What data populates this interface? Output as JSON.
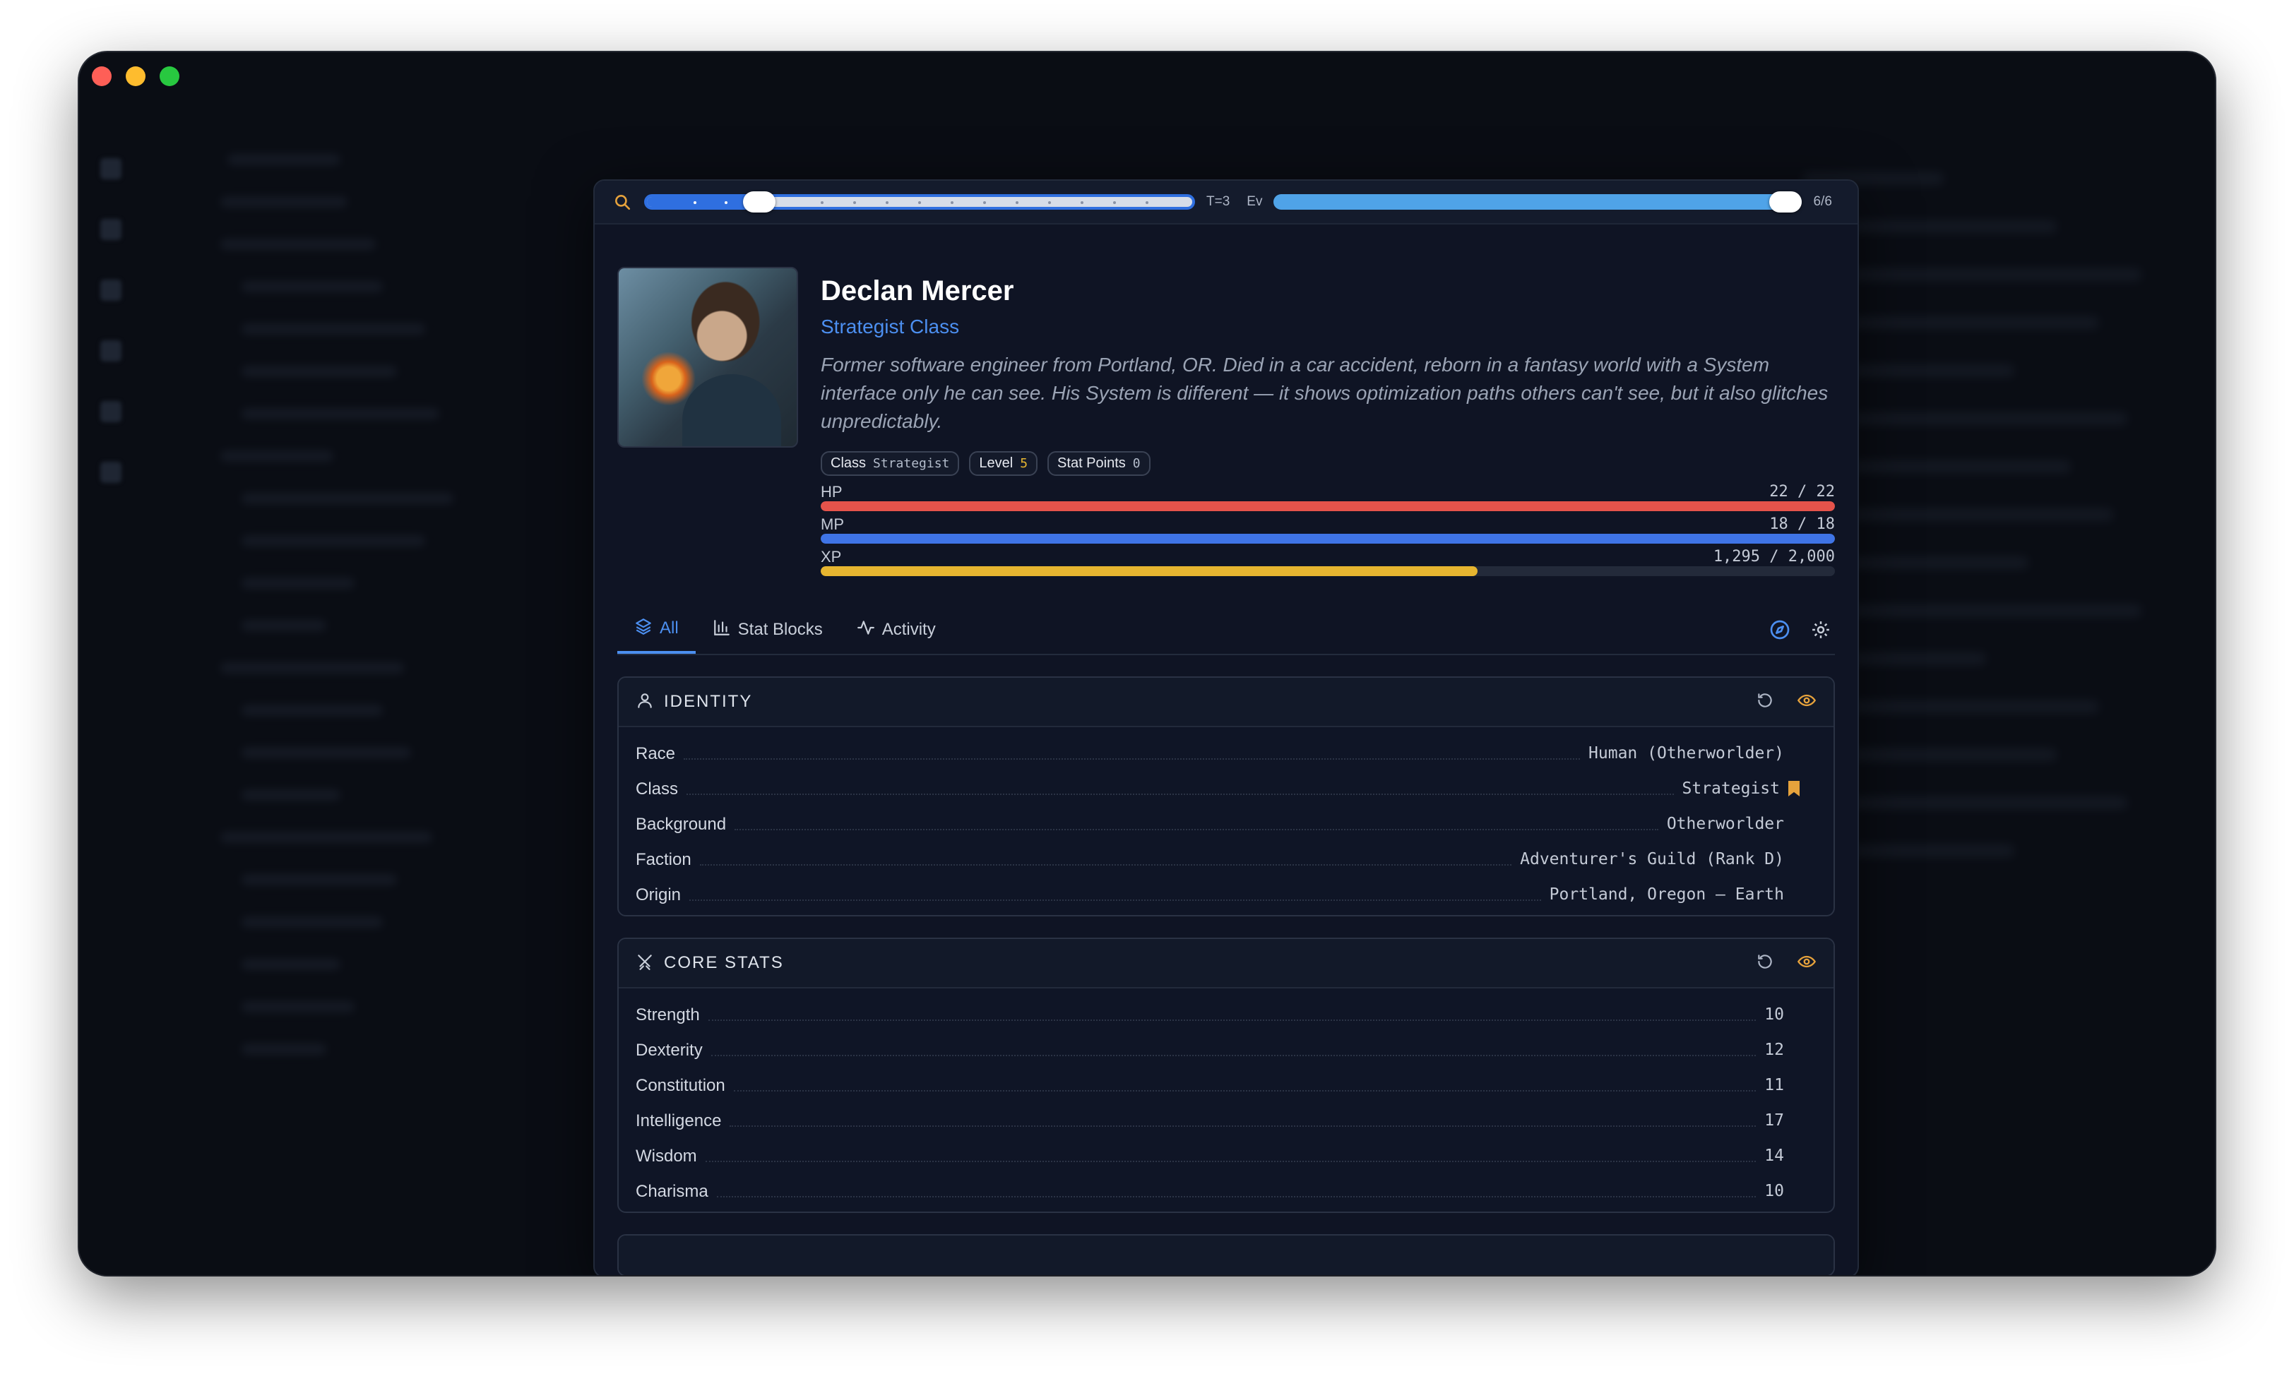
{
  "window": {
    "controls": [
      "close",
      "minimize",
      "zoom"
    ]
  },
  "topbar": {
    "timeline_label": "T=3",
    "timeline_progress": 0.2,
    "ev_label": "Ev",
    "ev_value": "6/6",
    "ev_progress": 1.0
  },
  "character": {
    "name": "Declan Mercer",
    "class_title": "Strategist Class",
    "bio": "Former software engineer from Portland, OR. Died in a car accident, reborn in a fantasy world with a System interface only he can see. His System is different — it shows optimization paths others can't see, but it also glitches unpredictably.",
    "chips": [
      {
        "label": "Class",
        "value": "Strategist"
      },
      {
        "label": "Level",
        "value": "5"
      },
      {
        "label": "Stat Points",
        "value": "0"
      }
    ],
    "bars": [
      {
        "label": "HP",
        "value_text": "22 / 22",
        "fraction": 1.0,
        "color": "#e5534b"
      },
      {
        "label": "MP",
        "value_text": "18 / 18",
        "fraction": 1.0,
        "color": "#3f74e6"
      },
      {
        "label": "XP",
        "value_text": "1,295 / 2,000",
        "fraction": 0.6475,
        "color": "#e6b530"
      }
    ]
  },
  "tabs": [
    {
      "label": "All",
      "icon": "layers-icon",
      "active": true
    },
    {
      "label": "Stat Blocks",
      "icon": "bar-chart-icon",
      "active": false
    },
    {
      "label": "Activity",
      "icon": "activity-icon",
      "active": false
    }
  ],
  "sections": {
    "identity": {
      "title": "IDENTITY",
      "rows": [
        {
          "key": "Race",
          "value": "Human (Otherworlder)"
        },
        {
          "key": "Class",
          "value": "Strategist",
          "bookmarked": true
        },
        {
          "key": "Background",
          "value": "Otherworlder"
        },
        {
          "key": "Faction",
          "value": "Adventurer's Guild (Rank D)"
        },
        {
          "key": "Origin",
          "value": "Portland, Oregon — Earth"
        }
      ]
    },
    "core_stats": {
      "title": "CORE STATS",
      "rows": [
        {
          "key": "Strength",
          "value": "10"
        },
        {
          "key": "Dexterity",
          "value": "12"
        },
        {
          "key": "Constitution",
          "value": "11"
        },
        {
          "key": "Intelligence",
          "value": "17"
        },
        {
          "key": "Wisdom",
          "value": "14"
        },
        {
          "key": "Charisma",
          "value": "10"
        }
      ]
    }
  },
  "colors": {
    "accent": "#4c8ff0",
    "warning": "#e6a23c",
    "panel_bg": "#0f1424"
  }
}
